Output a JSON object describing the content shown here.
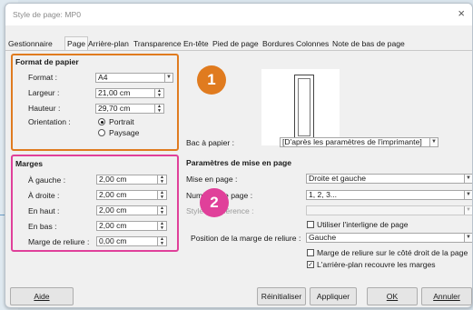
{
  "window": {
    "title": "Style de page: MP0",
    "close_glyph": "×"
  },
  "tabs": [
    "Gestionnaire",
    "Page",
    "Arrière-plan",
    "Transparence",
    "En-tête",
    "Pied de page",
    "Bordures",
    "Colonnes",
    "Note de bas de page"
  ],
  "active_tab": "Page",
  "format_papier": {
    "heading": "Format de papier",
    "format_label": "Format :",
    "format_value": "A4",
    "largeur_label": "Largeur :",
    "largeur_value": "21,00 cm",
    "hauteur_label": "Hauteur :",
    "hauteur_value": "29,70 cm",
    "orientation_label": "Orientation :",
    "portrait_label": "Portrait",
    "paysage_label": "Paysage",
    "portrait_selected": true
  },
  "bac": {
    "label": "Bac à papier :",
    "value": "[D'après les paramètres de l'imprimante]"
  },
  "marges": {
    "heading": "Marges",
    "gauche_label": "À gauche :",
    "gauche_value": "2,00 cm",
    "droite_label": "À droite :",
    "droite_value": "2,00 cm",
    "haut_label": "En haut :",
    "haut_value": "2,00 cm",
    "bas_label": "En bas :",
    "bas_value": "2,00 cm",
    "reliure_label": "Marge de reliure :",
    "reliure_value": "0,00 cm"
  },
  "mise_en_page": {
    "heading": "Paramètres de mise en page",
    "mise_label": "Mise en page :",
    "mise_value": "Droite et gauche",
    "numeros_label": "Numéros de page :",
    "numeros_value": "1, 2, 3...",
    "reference_label": "Style de référence :",
    "reference_value": "",
    "interligne_label": "Utiliser l'interligne de page",
    "interligne_checked": false,
    "position_label": "Position de la marge de reliure :",
    "position_value": "Gauche",
    "cote_droit_label": "Marge de reliure sur le côté droit de la page",
    "cote_droit_checked": false,
    "arriere_plan_label": "L'arrière-plan recouvre les marges",
    "arriere_plan_checked": true
  },
  "badges": {
    "one": "1",
    "two": "2",
    "one_color": "#e07b1f",
    "two_color": "#e0409a"
  },
  "buttons": {
    "aide": "Aide",
    "reinitialiser": "Réinitialiser",
    "appliquer": "Appliquer",
    "ok": "OK",
    "annuler": "Annuler"
  },
  "colors": {
    "frame1": "#e07b1f",
    "frame2": "#e0409a"
  }
}
